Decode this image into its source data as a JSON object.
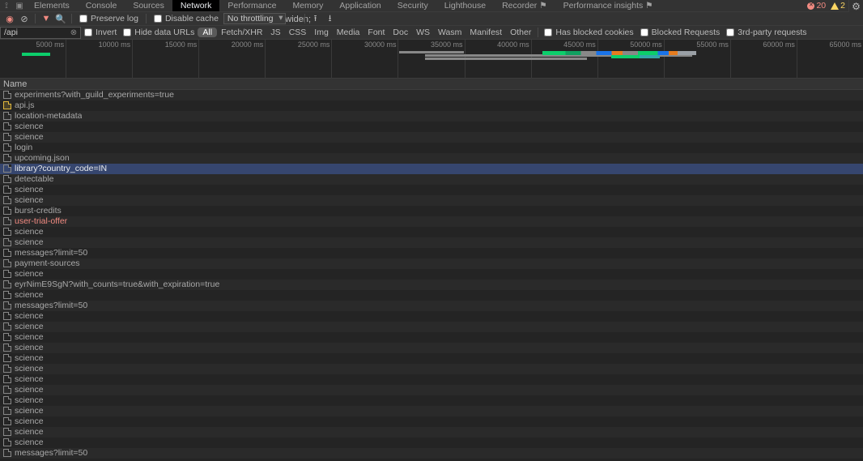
{
  "tabs": [
    {
      "label": "Elements"
    },
    {
      "label": "Console"
    },
    {
      "label": "Sources"
    },
    {
      "label": "Network",
      "active": true
    },
    {
      "label": "Performance"
    },
    {
      "label": "Memory"
    },
    {
      "label": "Application"
    },
    {
      "label": "Security"
    },
    {
      "label": "Lighthouse"
    },
    {
      "label": "Recorder ⚑"
    },
    {
      "label": "Performance insights ⚑"
    }
  ],
  "status": {
    "errors": "20",
    "warnings": "2"
  },
  "toolbar": {
    "preserve_log": "Preserve log",
    "disable_cache": "Disable cache",
    "no_throttling": "No throttling"
  },
  "filter": {
    "value": "/api",
    "invert": "Invert",
    "hide_data": "Hide data URLs",
    "types": [
      "All",
      "Fetch/XHR",
      "JS",
      "CSS",
      "Img",
      "Media",
      "Font",
      "Doc",
      "WS",
      "Wasm",
      "Manifest",
      "Other"
    ],
    "blocked_cookies": "Has blocked cookies",
    "blocked_requests": "Blocked Requests",
    "third_party": "3rd-party requests"
  },
  "overview_ticks": [
    "5000 ms",
    "10000 ms",
    "15000 ms",
    "20000 ms",
    "25000 ms",
    "30000 ms",
    "35000 ms",
    "40000 ms",
    "45000 ms",
    "50000 ms",
    "55000 ms",
    "60000 ms",
    "65000 ms"
  ],
  "header": {
    "name": "Name"
  },
  "requests": [
    {
      "name": "experiments?with_guild_experiments=true",
      "kind": "doc"
    },
    {
      "name": "api.js",
      "kind": "js"
    },
    {
      "name": "location-metadata",
      "kind": "doc"
    },
    {
      "name": "science",
      "kind": "doc"
    },
    {
      "name": "science",
      "kind": "doc"
    },
    {
      "name": "login",
      "kind": "doc"
    },
    {
      "name": "upcoming.json",
      "kind": "doc"
    },
    {
      "name": "library?country_code=IN",
      "kind": "doc",
      "selected": true
    },
    {
      "name": "detectable",
      "kind": "doc"
    },
    {
      "name": "science",
      "kind": "doc"
    },
    {
      "name": "science",
      "kind": "doc"
    },
    {
      "name": "burst-credits",
      "kind": "doc"
    },
    {
      "name": "user-trial-offer",
      "kind": "doc",
      "error": true
    },
    {
      "name": "science",
      "kind": "doc"
    },
    {
      "name": "science",
      "kind": "doc"
    },
    {
      "name": "messages?limit=50",
      "kind": "doc"
    },
    {
      "name": "payment-sources",
      "kind": "doc"
    },
    {
      "name": "science",
      "kind": "doc"
    },
    {
      "name": "eyrNimE9SgN?with_counts=true&with_expiration=true",
      "kind": "doc"
    },
    {
      "name": "science",
      "kind": "doc"
    },
    {
      "name": "messages?limit=50",
      "kind": "doc"
    },
    {
      "name": "science",
      "kind": "doc"
    },
    {
      "name": "science",
      "kind": "doc"
    },
    {
      "name": "science",
      "kind": "doc"
    },
    {
      "name": "science",
      "kind": "doc"
    },
    {
      "name": "science",
      "kind": "doc"
    },
    {
      "name": "science",
      "kind": "doc"
    },
    {
      "name": "science",
      "kind": "doc"
    },
    {
      "name": "science",
      "kind": "doc"
    },
    {
      "name": "science",
      "kind": "doc"
    },
    {
      "name": "science",
      "kind": "doc"
    },
    {
      "name": "science",
      "kind": "doc"
    },
    {
      "name": "science",
      "kind": "doc"
    },
    {
      "name": "science",
      "kind": "doc"
    },
    {
      "name": "messages?limit=50",
      "kind": "doc"
    }
  ]
}
